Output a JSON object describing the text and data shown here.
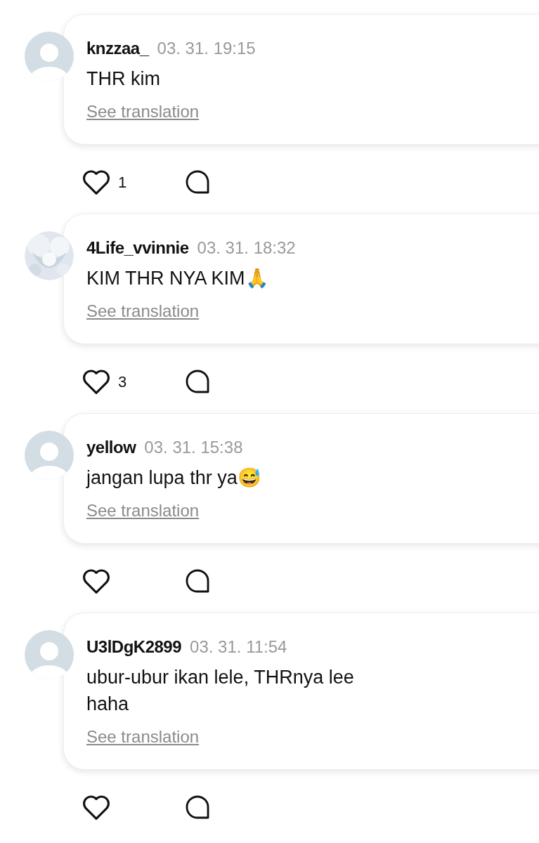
{
  "comments": [
    {
      "avatar": {
        "kind": "default"
      },
      "username": "knzzaa_",
      "time": "03. 31. 19:15",
      "text": "THR kim",
      "translate": "See translation",
      "likes": "1"
    },
    {
      "username": "4Life_vvinnie",
      "time": "03. 31. 18:32",
      "text": "KIM THR NYA KIM🙏",
      "translate": "See translation",
      "likes": "3"
    },
    {
      "avatar": {
        "kind": "default"
      },
      "username": "yellow",
      "time": "03. 31. 15:38",
      "text": "jangan lupa thr ya😅",
      "translate": "See translation"
    },
    {
      "avatar": {
        "kind": "default"
      },
      "username": "U3lDgK2899",
      "time": "03. 31. 11:54",
      "text": "ubur-ubur ikan lele, THRnya lee haha",
      "translate": "See translation"
    }
  ]
}
